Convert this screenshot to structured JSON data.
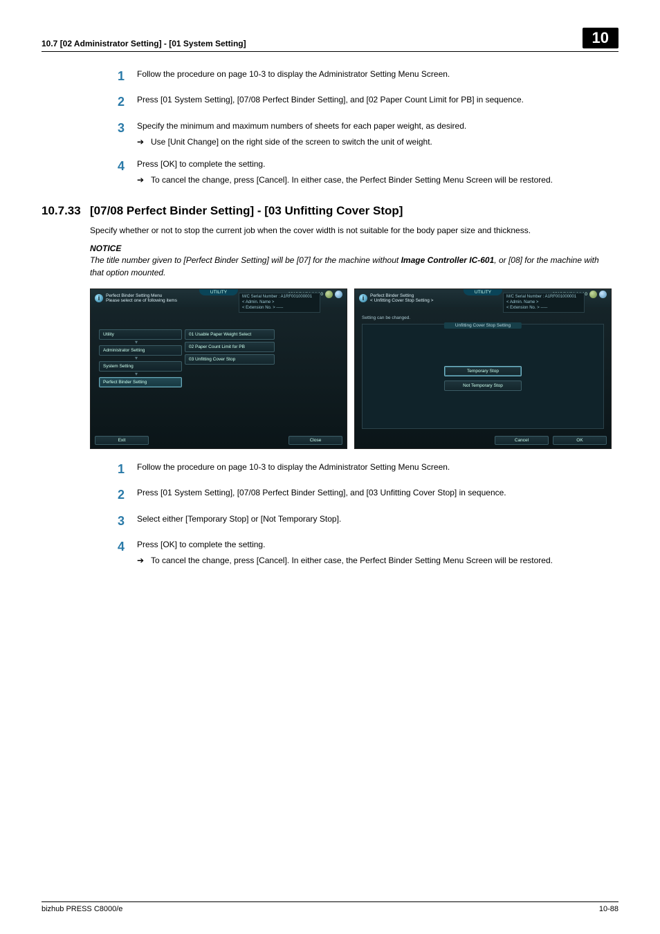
{
  "header": {
    "section_path": "10.7    [02 Administrator Setting] - [01 System Setting]",
    "chapter_number": "10"
  },
  "block_a": {
    "steps": [
      {
        "n": "1",
        "text": "Follow the procedure on page 10-3 to display the Administrator Setting Menu Screen.",
        "subs": []
      },
      {
        "n": "2",
        "text": "Press [01 System Setting], [07/08 Perfect Binder Setting], and [02 Paper Count Limit for PB] in sequence.",
        "subs": []
      },
      {
        "n": "3",
        "text": "Specify the minimum and maximum numbers of sheets for each paper weight, as desired.",
        "subs": [
          "Use [Unit Change] on the right side of the screen to switch the unit of weight."
        ]
      },
      {
        "n": "4",
        "text": "Press [OK] to complete the setting.",
        "subs": [
          "To cancel the change, press [Cancel]. In either case, the Perfect Binder Setting Menu Screen will be restored."
        ]
      }
    ]
  },
  "section": {
    "number": "10.7.33",
    "title": "[07/08 Perfect Binder Setting] - [03 Unfitting Cover Stop]",
    "intro": "Specify whether or not to stop the current job when the cover width is not suitable for the body paper size and thickness.",
    "notice_label": "NOTICE",
    "notice_text_pre": "The title number given to [Perfect Binder Setting] will be [07] for the machine without ",
    "notice_bold": "Image Controller IC-601",
    "notice_text_post": ", or [08] for the machine with that option mounted."
  },
  "screens": {
    "common": {
      "utility_tab": "UTILITY",
      "datetime": "2010/04/04  14:10",
      "serial_line": "M/C Serial Number : A1RF001000001",
      "admin_line": "< Admin. Name >",
      "ext_line": "< Extension No. >  -----"
    },
    "left": {
      "title_l1": "Perfect Binder Setting Menu",
      "title_l2": "Please select one of following items",
      "chain": [
        "Utility",
        "Administrator Setting",
        "System Setting",
        "Perfect Binder Setting"
      ],
      "chain_selected_index": 3,
      "menu": [
        "01 Usable Paper Weight Select",
        "02 Paper Count Limit for PB",
        "03 Unfitting Cover Stop"
      ],
      "footer_left": "Exit",
      "footer_right": "Close"
    },
    "right": {
      "title_l1": "Perfect Binder Setting",
      "title_l2": "< Unfitting Cover Stop Setting >",
      "status": "Setting can be changed.",
      "card_title": "Unfitting Cover Stop Setting",
      "options": [
        "Temporary Stop",
        "Not Temporary Stop"
      ],
      "selected_option_index": 0,
      "footer_cancel": "Cancel",
      "footer_ok": "OK"
    }
  },
  "block_b": {
    "steps": [
      {
        "n": "1",
        "text": "Follow the procedure on page 10-3 to display the Administrator Setting Menu Screen.",
        "subs": []
      },
      {
        "n": "2",
        "text": "Press [01 System Setting], [07/08 Perfect Binder Setting], and [03 Unfitting Cover Stop] in sequence.",
        "subs": []
      },
      {
        "n": "3",
        "text": "Select either [Temporary Stop] or [Not Temporary Stop].",
        "subs": []
      },
      {
        "n": "4",
        "text": "Press [OK] to complete the setting.",
        "subs": [
          "To cancel the change, press [Cancel]. In either case, the Perfect Binder Setting Menu Screen will be restored."
        ]
      }
    ]
  },
  "footer": {
    "product": "bizhub PRESS C8000/e",
    "page": "10-88"
  }
}
